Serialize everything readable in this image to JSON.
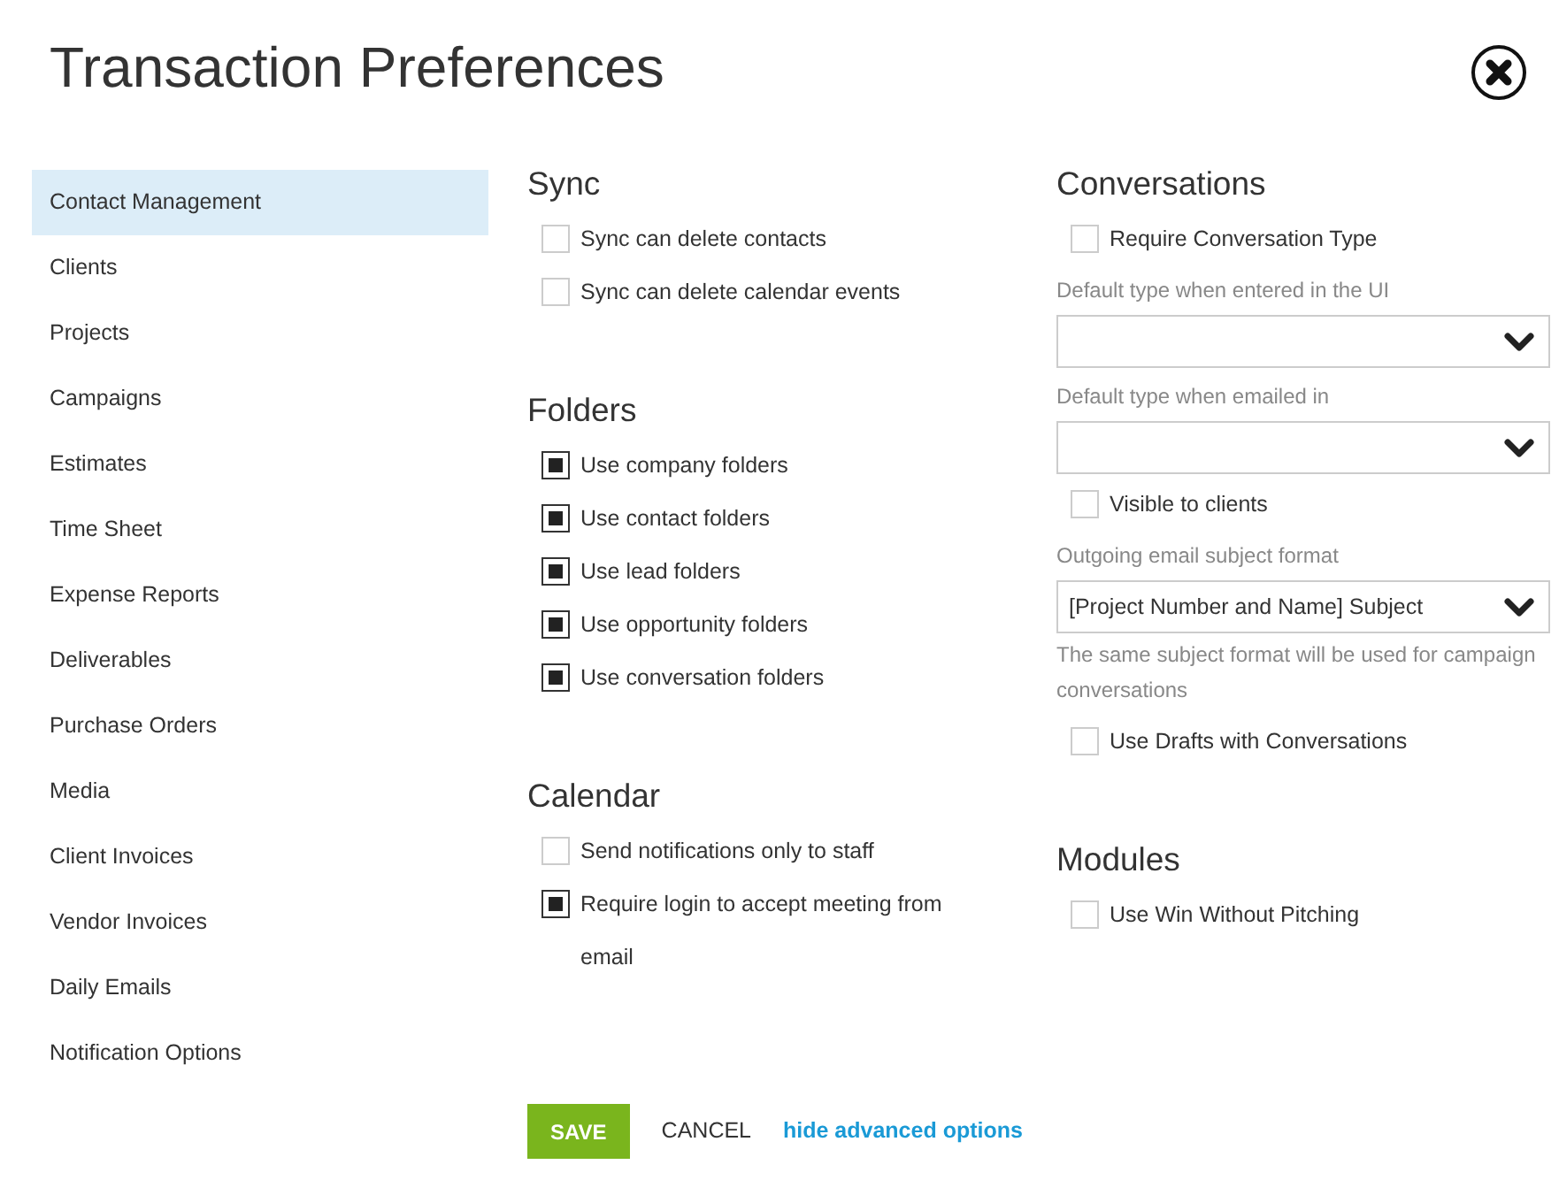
{
  "title": "Transaction Preferences",
  "sidebar": {
    "items": [
      {
        "label": "Contact Management",
        "selected": true
      },
      {
        "label": "Clients",
        "selected": false
      },
      {
        "label": "Projects",
        "selected": false
      },
      {
        "label": "Campaigns",
        "selected": false
      },
      {
        "label": "Estimates",
        "selected": false
      },
      {
        "label": "Time Sheet",
        "selected": false
      },
      {
        "label": "Expense Reports",
        "selected": false
      },
      {
        "label": "Deliverables",
        "selected": false
      },
      {
        "label": "Purchase Orders",
        "selected": false
      },
      {
        "label": "Media",
        "selected": false
      },
      {
        "label": "Client Invoices",
        "selected": false
      },
      {
        "label": "Vendor Invoices",
        "selected": false
      },
      {
        "label": "Daily Emails",
        "selected": false
      },
      {
        "label": "Notification Options",
        "selected": false
      }
    ]
  },
  "columns": [
    [
      {
        "heading": "Sync",
        "items": [
          {
            "kind": "checkbox",
            "label": "Sync can delete contacts",
            "checked": false
          },
          {
            "kind": "checkbox",
            "label": "Sync can delete calendar events",
            "checked": false
          }
        ]
      },
      {
        "heading": "Folders",
        "items": [
          {
            "kind": "checkbox",
            "label": "Use company folders",
            "checked": true
          },
          {
            "kind": "checkbox",
            "label": "Use contact folders",
            "checked": true
          },
          {
            "kind": "checkbox",
            "label": "Use lead folders",
            "checked": true
          },
          {
            "kind": "checkbox",
            "label": "Use opportunity folders",
            "checked": true
          },
          {
            "kind": "checkbox",
            "label": "Use conversation folders",
            "checked": true
          }
        ]
      },
      {
        "heading": "Calendar",
        "items": [
          {
            "kind": "checkbox",
            "label": "Send notifications only to staff",
            "checked": false
          },
          {
            "kind": "checkbox",
            "label": "Require login to accept meeting from email",
            "checked": true
          }
        ]
      }
    ],
    [
      {
        "heading": "Conversations",
        "items": [
          {
            "kind": "checkbox",
            "label": "Require Conversation Type",
            "checked": false
          },
          {
            "kind": "select",
            "label": "Default type when entered in the UI"
          },
          {
            "kind": "select",
            "label": "Default type when emailed in"
          },
          {
            "kind": "checkbox",
            "label": "Visible to clients",
            "checked": false
          },
          {
            "kind": "select",
            "label": "Outgoing email subject format",
            "value": "[Project Number and Name] Subject"
          },
          {
            "kind": "help",
            "label": "The same subject format will be used for campaign conversations"
          },
          {
            "kind": "checkbox",
            "label": "Use Drafts with Conversations",
            "checked": false
          }
        ]
      },
      {
        "heading": "Modules",
        "items": [
          {
            "kind": "checkbox",
            "label": "Use Win Without Pitching",
            "checked": false
          }
        ]
      }
    ]
  ],
  "footer": {
    "save": "SAVE",
    "cancel": "CANCEL",
    "link": "hide advanced options"
  }
}
